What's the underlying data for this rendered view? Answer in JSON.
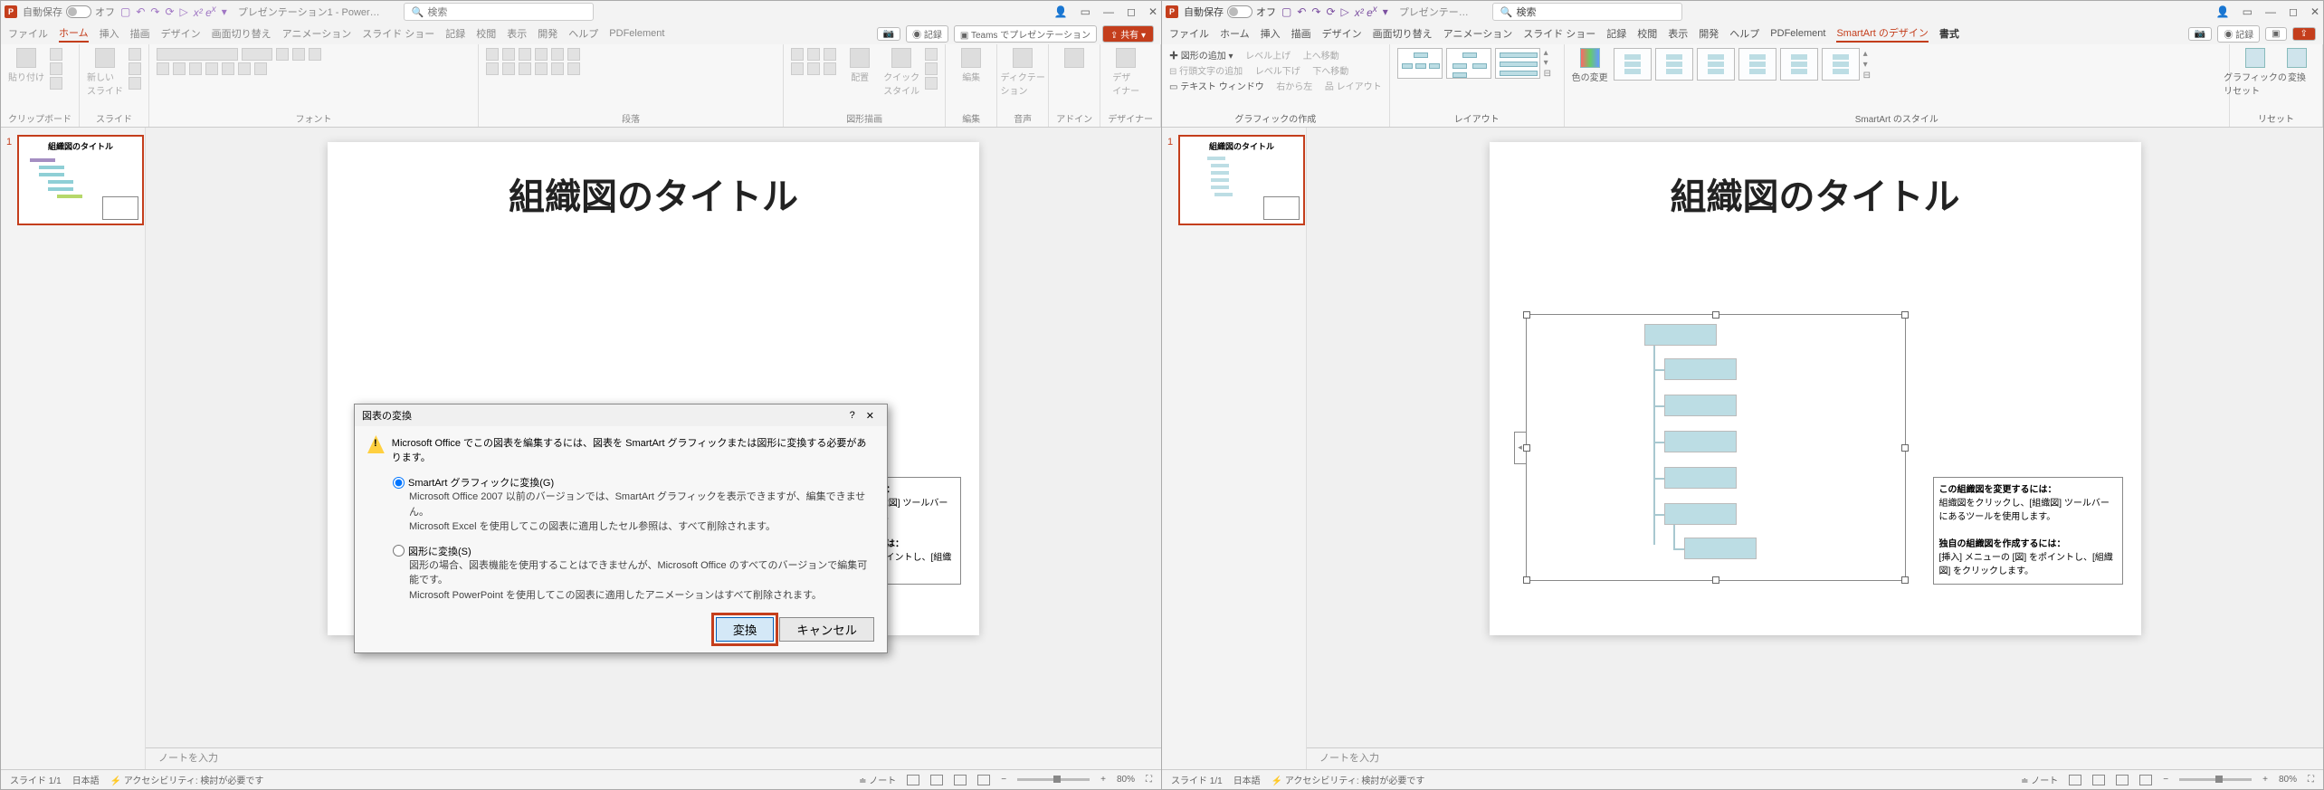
{
  "left": {
    "titlebar": {
      "autosave": "自動保存",
      "autosave_state": "オフ",
      "doc": "プレゼンテーション1 - Power…",
      "search": "検索"
    },
    "tabs": [
      "ファイル",
      "ホーム",
      "挿入",
      "描画",
      "デザイン",
      "画面切り替え",
      "アニメーション",
      "スライド ショー",
      "記録",
      "校閲",
      "表示",
      "開発",
      "ヘルプ",
      "PDFelement"
    ],
    "tabs_active": "ホーム",
    "tab_extras": {
      "rec": "記録",
      "teams": "Teams でプレゼンテーション",
      "share": "共有"
    },
    "ribbon_groups": {
      "clipboard": "クリップボード",
      "clipboard_paste": "貼り付け",
      "slides": "スライド",
      "slides_new": "新しい\nスライド",
      "font": "フォント",
      "para": "段落",
      "draw": "図形描画",
      "draw_arrange": "配置",
      "draw_quick": "クイック\nスタイル",
      "edit": "編集",
      "edit_btn": "編集",
      "voice": "音声",
      "voice_btn": "ディクテー\nション",
      "designer": "デザイナー",
      "designer_btn": "デザ\nイナー",
      "addin": "アドイン"
    },
    "slide": {
      "title": "組織図のタイトル"
    },
    "tip": {
      "h1": "この組織図を変更するには：",
      "l1": "組織図をクリックし、[組織図] ツールバーにあるツールを使用します。",
      "h2": "独自の組織図を作成するには：",
      "l2": "[挿入] メニューの [図] をポイントし、[組織図] をクリックします。"
    },
    "dialog": {
      "title": "図表の変換",
      "warn": "Microsoft Office でこの図表を編集するには、図表を SmartArt グラフィックまたは図形に変換する必要があります。",
      "opt1": "SmartArt グラフィックに変換(G)",
      "opt1_desc": "Microsoft Office 2007 以前のバージョンでは、SmartArt グラフィックを表示できますが、編集できません。\nMicrosoft Excel を使用してこの図表に適用したセル参照は、すべて削除されます。",
      "opt2": "図形に変換(S)",
      "opt2_desc": "図形の場合、図表機能を使用することはできませんが、Microsoft Office のすべてのバージョンで編集可能です。\nMicrosoft PowerPoint を使用してこの図表に適用したアニメーションはすべて削除されます。",
      "ok": "変換",
      "cancel": "キャンセル"
    },
    "notes": "ノートを入力",
    "status": {
      "slide": "スライド 1/1",
      "lang": "日本語",
      "a11y": "アクセシビリティ: 検討が必要です",
      "notesbtn": "ノート",
      "zoom": "80%"
    }
  },
  "right": {
    "titlebar": {
      "autosave": "自動保存",
      "autosave_state": "オフ",
      "doc": "プレゼンテー…",
      "search": "検索"
    },
    "tabs": [
      "ファイル",
      "ホーム",
      "挿入",
      "描画",
      "デザイン",
      "画面切り替え",
      "アニメーション",
      "スライド ショー",
      "記録",
      "校閲",
      "表示",
      "開発",
      "ヘルプ",
      "PDFelement",
      "SmartArt のデザイン",
      "書式"
    ],
    "tabs_active": "SmartArt のデザイン",
    "tab_extras": {
      "rec": "記録",
      "share": ""
    },
    "ribbon": {
      "create": {
        "label": "グラフィックの作成",
        "add_shape": "図形の追加",
        "text_window": "テキスト ウィンドウ",
        "level_up": "レベル上げ",
        "level_down": "レベル下げ",
        "up": "上へ移動",
        "down": "下へ移動",
        "rtl": "右から左",
        "layout": "品 レイアウト"
      },
      "layouts": "レイアウト",
      "styles": {
        "label": "SmartArt のスタイル",
        "color": "色の変更"
      },
      "reset": {
        "label": "リセット",
        "reset_btn": "グラフィックの\nリセット",
        "convert": "変換"
      }
    },
    "slide": {
      "title": "組織図のタイトル"
    },
    "tip": {
      "h1": "この組織図を変更するには：",
      "l1": "組織図をクリックし、[組織図] ツールバーにあるツールを使用します。",
      "h2": "独自の組織図を作成するには：",
      "l2": "[挿入] メニューの [図] をポイントし、[組織図] をクリックします。"
    },
    "notes": "ノートを入力",
    "status": {
      "slide": "スライド 1/1",
      "lang": "日本語",
      "a11y": "アクセシビリティ: 検討が必要です",
      "notesbtn": "ノート",
      "zoom": "80%"
    }
  }
}
